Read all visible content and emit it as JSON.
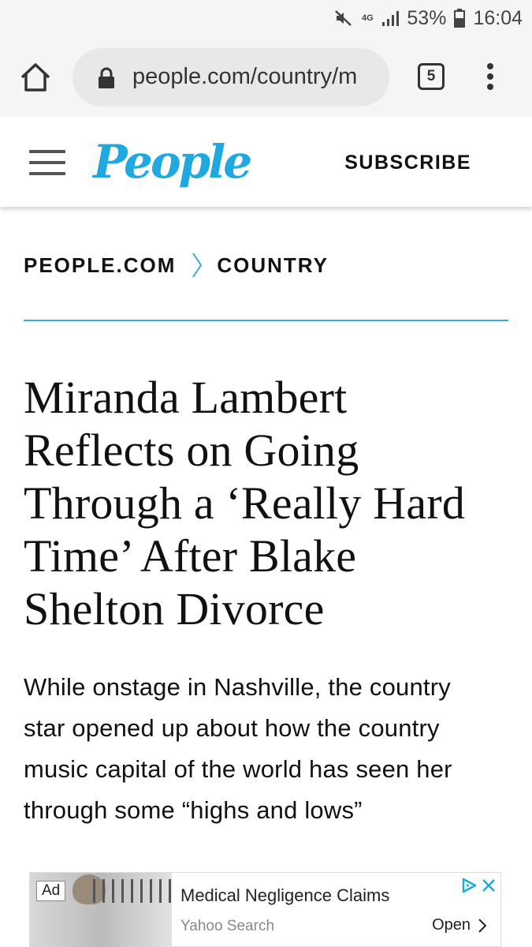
{
  "status_bar": {
    "network": "4G",
    "battery": "53%",
    "time": "16:04",
    "icons": [
      "mute-icon",
      "network-icon",
      "signal-icon",
      "battery-icon"
    ]
  },
  "browser": {
    "url": "people.com/country/m",
    "tab_count": "5",
    "icons": [
      "home-icon",
      "lock-icon",
      "tabs-icon",
      "more-vert-icon"
    ]
  },
  "site_header": {
    "logo": "People",
    "subscribe": "SUBSCRIBE",
    "brand_color": "#1fa9e0"
  },
  "breadcrumb": {
    "items": [
      "PEOPLE.COM",
      "COUNTRY"
    ]
  },
  "article": {
    "headline": "Miranda Lambert Reflects on Going Through a ‘Really Hard Time’ After Blake Shelton Divorce",
    "dek": "While onstage in Nashville, the country star opened up about how the country music capital of the world has seen her through some “highs and lows”"
  },
  "ad": {
    "label": "Ad",
    "title": "Medical Negligence Claims",
    "source": "Yahoo Search",
    "cta": "Open"
  }
}
